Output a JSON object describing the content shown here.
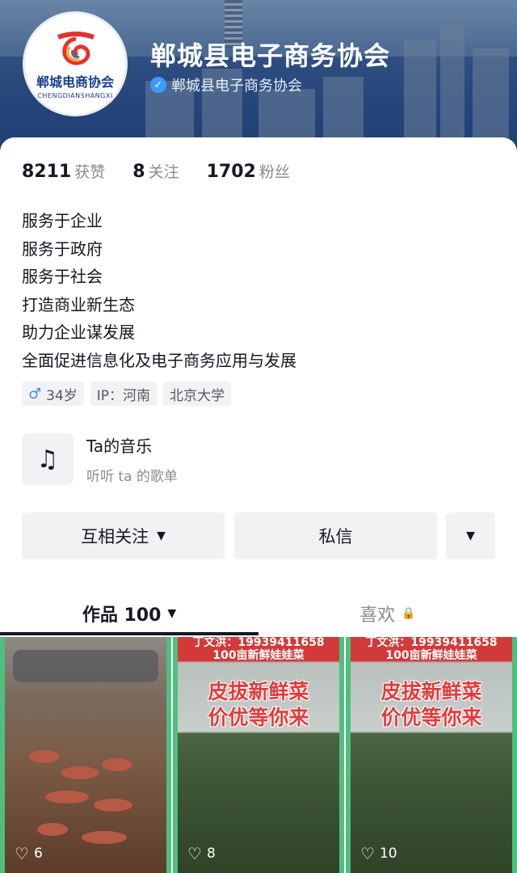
{
  "header": {
    "title": "郸城县电子商务协会",
    "verified_label": "郸城县电子商务协会",
    "logo_text": "郸城电商协会",
    "logo_sub": "CHENGDIANSHANGXI"
  },
  "stats": [
    {
      "num": "8211",
      "label": "获赞"
    },
    {
      "num": "8",
      "label": "关注"
    },
    {
      "num": "1702",
      "label": "粉丝"
    }
  ],
  "bio": [
    "服务于企业",
    "服务于政府",
    "服务于社会",
    "打造商业新生态",
    "助力企业谋发展",
    "全面促进信息化及电子商务应用与发展"
  ],
  "tags": {
    "age": "34岁",
    "ip": "IP：河南",
    "school": "北京大学"
  },
  "music": {
    "title": "Ta的音乐",
    "subtitle": "听听 ta 的歌单"
  },
  "buttons": {
    "follow": "互相关注",
    "message": "私信"
  },
  "tabs": {
    "works": "作品 100",
    "likes": "喜欢"
  },
  "videos": [
    {
      "likes": "6"
    },
    {
      "likes": "8",
      "phone": "丁文洪：19939411658",
      "sub": "100亩新鲜娃娃菜",
      "headline1": "皮拔新鲜菜",
      "headline2": "价优等你来"
    },
    {
      "likes": "10",
      "phone": "丁文洪：19939411658",
      "sub": "100亩新鲜娃娃菜",
      "headline1": "皮拔新鲜菜",
      "headline2": "价优等你来"
    }
  ],
  "colors": {
    "verified": "#3b9cff",
    "male": "#3e8ef7",
    "accent_red": "#d23a3a"
  }
}
